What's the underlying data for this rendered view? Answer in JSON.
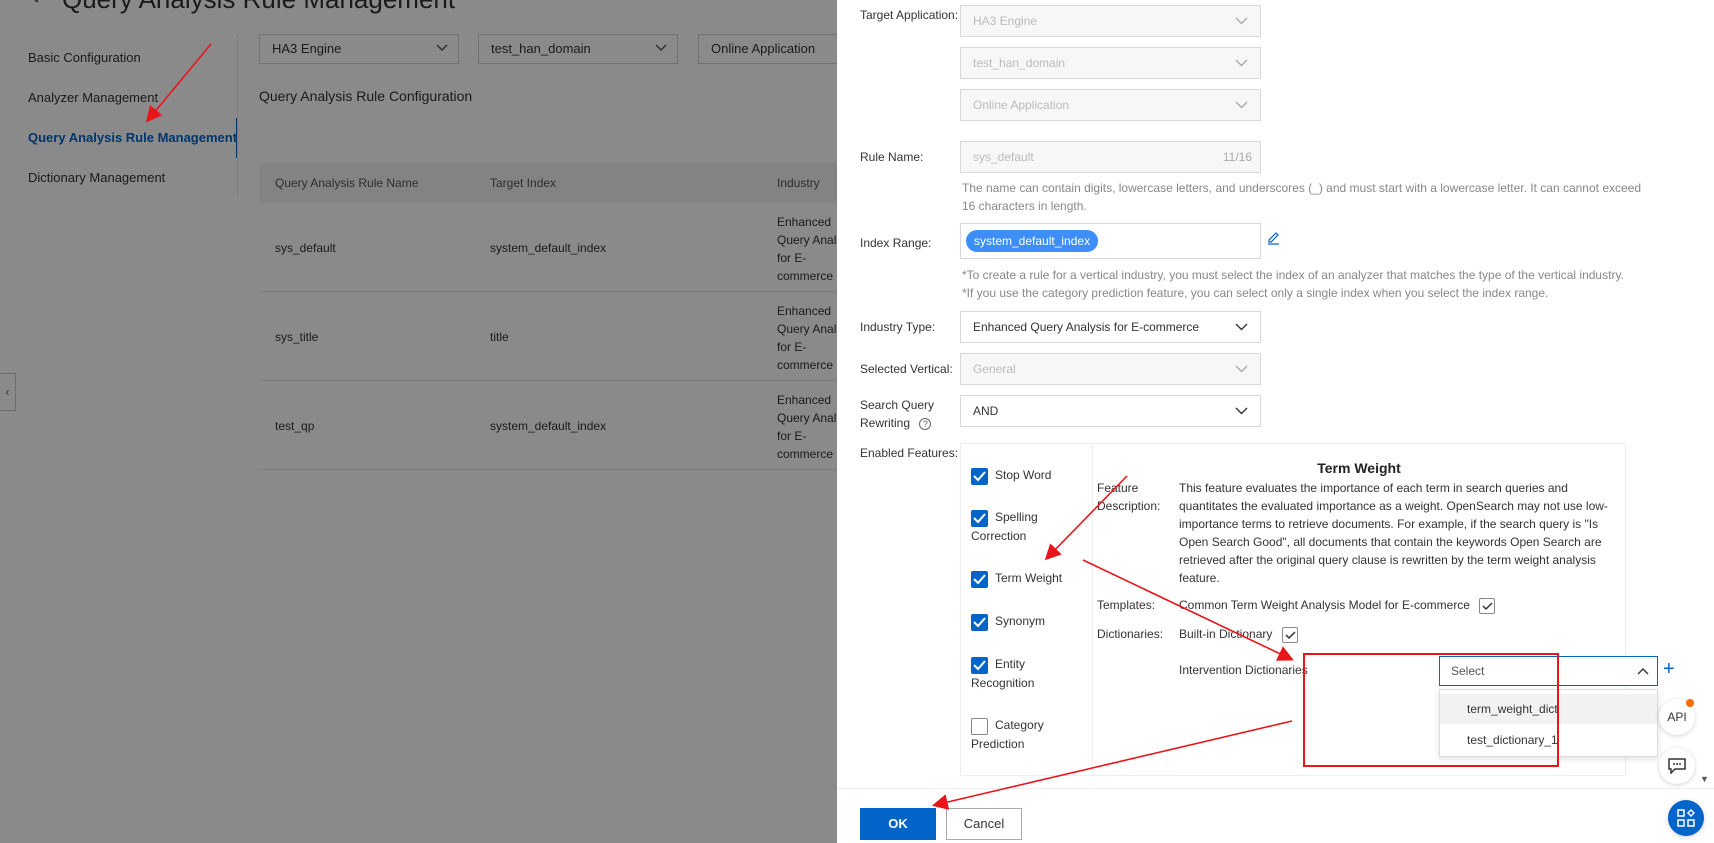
{
  "page": {
    "title": "Query Analysis Rule Management",
    "nav": [
      {
        "label": "Basic Configuration",
        "active": false
      },
      {
        "label": "Analyzer Management",
        "active": false
      },
      {
        "label": "Query Analysis Rule Management",
        "active": true
      },
      {
        "label": "Dictionary Management",
        "active": false
      }
    ],
    "filters": [
      "HA3 Engine",
      "test_han_domain",
      "Online Application"
    ],
    "section_title": "Query Analysis Rule Configuration",
    "table": {
      "headers": [
        "Query Analysis Rule Name",
        "Target Index",
        "Industry"
      ],
      "rows": [
        {
          "name": "sys_default",
          "index": "system_default_index",
          "industry": "Enhanced Query Anal for E-commerce"
        },
        {
          "name": "sys_title",
          "index": "title",
          "industry": "Enhanced Query Anal for E-commerce"
        },
        {
          "name": "test_qp",
          "index": "system_default_index",
          "industry": "Enhanced Query Anal for E-commerce"
        }
      ]
    }
  },
  "drawer": {
    "target_app_label": "Target Application:",
    "target_app_values": [
      "HA3 Engine",
      "test_han_domain",
      "Online Application"
    ],
    "rule_name_label": "Rule Name:",
    "rule_name_value": "sys_default",
    "rule_name_counter": "11/16",
    "rule_name_hint": "The name can contain digits, lowercase letters, and underscores (_) and must start with a lowercase letter. It can cannot exceed 16 characters in length.",
    "index_range_label": "Index Range:",
    "index_range_tag": "system_default_index",
    "index_hint_1": "*To create a rule for a vertical industry, you must select the index of an analyzer that matches the type of the vertical industry.",
    "index_hint_2": "*If you use the category prediction feature, you can select only a single index when you select the index range.",
    "industry_type_label": "Industry Type:",
    "industry_type_value": "Enhanced Query Analysis for E-commerce",
    "vertical_label": "Selected Vertical:",
    "vertical_value": "General",
    "rewrite_label": "Search Query Rewriting",
    "rewrite_help": "?",
    "rewrite_value": "AND",
    "features_label": "Enabled Features:",
    "features": [
      {
        "label": "Stop Word",
        "checked": true
      },
      {
        "label": "Spelling Correction",
        "checked": true
      },
      {
        "label": "Term Weight",
        "checked": true
      },
      {
        "label": "Synonym",
        "checked": true
      },
      {
        "label": "Entity Recognition",
        "checked": true
      },
      {
        "label": "Category Prediction",
        "checked": false
      }
    ],
    "detail": {
      "title": "Term Weight",
      "desc_label": "Feature Description:",
      "desc_text": "This feature evaluates the importance of each term in search queries and quantitates the evaluated importance as a weight. OpenSearch may not use low-importance terms to retrieve documents. For example, if the search query is \"Is Open Search Good\", all documents that contain the keywords Open Search are retrieved after the original query clause is rewritten by the term weight analysis feature.",
      "templates_label": "Templates:",
      "templates_value": "Common Term Weight Analysis Model for E-commerce",
      "dictionaries_label": "Dictionaries:",
      "dictionaries_value": "Built-in Dictionary",
      "intervention_label": "Intervention Dictionaries",
      "intervention_placeholder": "Select",
      "add_symbol": "+",
      "options": [
        "term_weight_dict",
        "test_dictionary_1"
      ]
    },
    "ok_label": "OK",
    "cancel_label": "Cancel"
  },
  "widgets": {
    "api_label": "API"
  },
  "colors": {
    "primary": "#0064c8",
    "tag": "#3d8ef8",
    "annotation": "#e8151b"
  }
}
